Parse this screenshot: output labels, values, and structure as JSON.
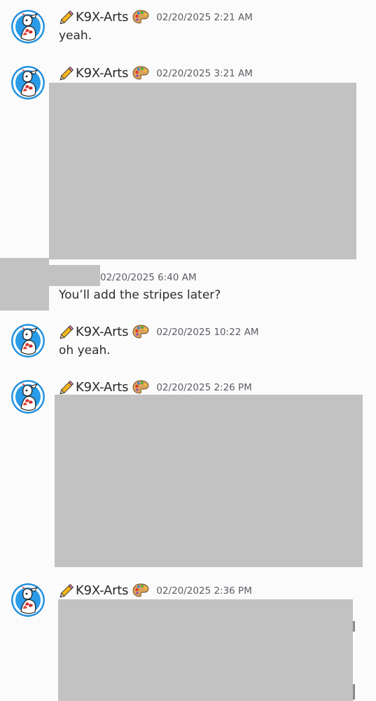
{
  "messages": [
    {
      "author": "K9X-Arts",
      "timestamp": "02/20/2025 2:21 AM",
      "text": "yeah."
    },
    {
      "author": "K9X-Arts",
      "timestamp": "02/20/2025 3:21 AM",
      "text": "",
      "attachment": "image"
    },
    {
      "author": "",
      "timestamp": "02/20/2025 6:40 AM",
      "text": "You’ll add the stripes later?"
    },
    {
      "author": "K9X-Arts",
      "timestamp": "02/20/2025 10:22 AM",
      "text": "oh yeah."
    },
    {
      "author": "K9X-Arts",
      "timestamp": "02/20/2025 2:26 PM",
      "text": "",
      "attachment": "image"
    },
    {
      "author": "K9X-Arts",
      "timestamp": "02/20/2025 2:36 PM",
      "text": "",
      "attachment": "image"
    }
  ],
  "icons": {
    "name_prefix": "pencil-icon",
    "name_suffix": "artist-palette-icon",
    "avatar": "goat-character-avatar"
  },
  "colors": {
    "background": "#fbfbfb",
    "username": "#2a2a2e",
    "timestamp": "#5c5e66",
    "message": "#2b2c30",
    "redacted": "#c2c2c2",
    "avatar_ring": "#1e88d8"
  }
}
